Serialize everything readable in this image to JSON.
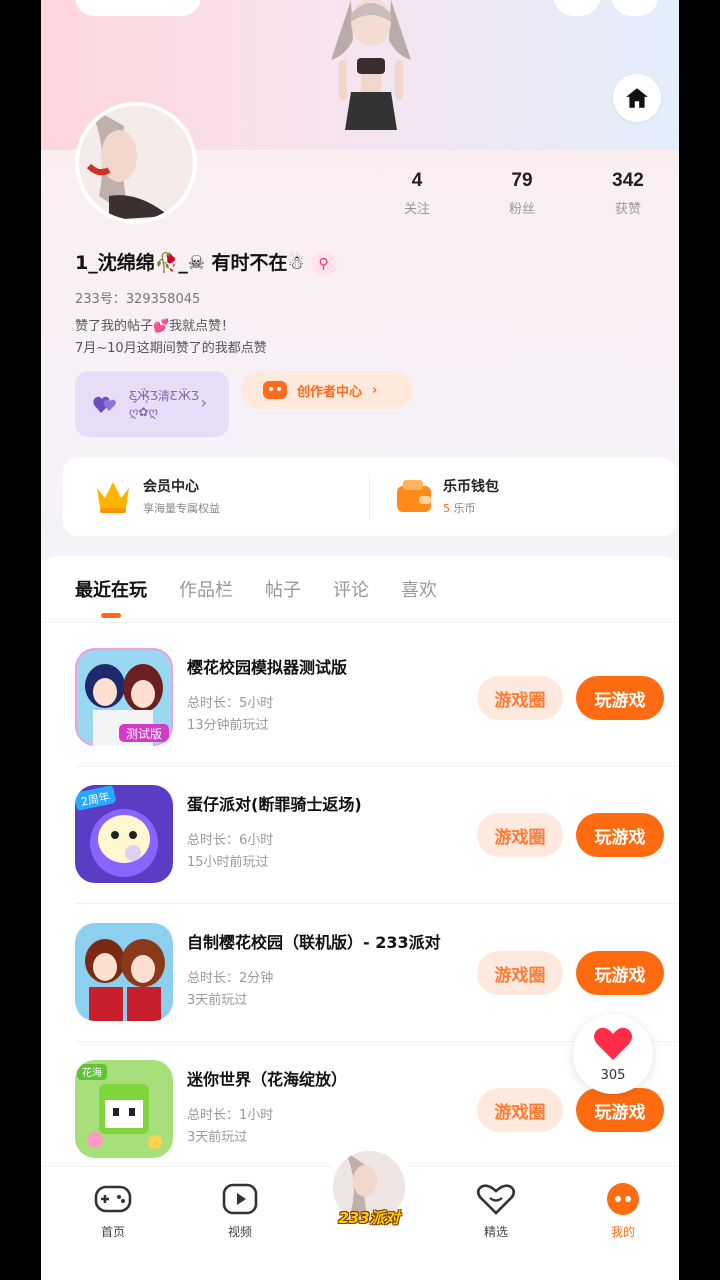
{
  "profile": {
    "nickname": "1_沈绵绵🥀_☠ 有时不在☃",
    "uid": "233号：329358045",
    "bio": [
      "赞了我的帖子💕我就点赞！",
      "7月~10月这期间赞了的我都点赞"
    ],
    "stats": [
      {
        "value": "4",
        "label": "关注"
      },
      {
        "value": "79",
        "label": "粉丝"
      },
      {
        "value": "342",
        "label": "获赞"
      }
    ],
    "friend_card_text": [
      "Ƹ̵̡Ӝ̵̨̄Ʒ清ƸӜƷ",
      "ღ✿ღ"
    ],
    "creator_center": "创作者中心"
  },
  "services": {
    "vip": {
      "title": "会员中心",
      "subtitle": "享海量专属权益"
    },
    "wallet": {
      "title": "乐币钱包",
      "amount": "5",
      "unit": "乐币"
    }
  },
  "tabs": [
    "最近在玩",
    "作品栏",
    "帖子",
    "评论",
    "喜欢"
  ],
  "games": [
    {
      "name": "樱花校园模拟器测试版",
      "duration": "总时长：5小时",
      "last_played": "13分钟前玩过",
      "circle_label": "游戏圈",
      "play_label": "玩游戏",
      "icon_badge": "测试版"
    },
    {
      "name": "蛋仔派对(断罪骑士返场)",
      "duration": "总时长：6小时",
      "last_played": "15小时前玩过",
      "circle_label": "游戏圈",
      "play_label": "玩游戏",
      "icon_badge": "2周年"
    },
    {
      "name": "自制樱花校园（联机版）- 233派对",
      "duration": "总时长：2分钟",
      "last_played": "3天前玩过",
      "circle_label": "游戏圈",
      "play_label": "玩游戏",
      "icon_badge": ""
    },
    {
      "name": "迷你世界（花海绽放）",
      "duration": "总时长：1小时",
      "last_played": "3天前玩过",
      "circle_label": "游戏圈",
      "play_label": "玩游戏",
      "icon_badge": "花海"
    }
  ],
  "like_float": {
    "count": "305"
  },
  "nav": [
    {
      "label": "首页",
      "icon": "gamepad-icon"
    },
    {
      "label": "视频",
      "icon": "video-icon"
    },
    {
      "label": "233派对",
      "icon": "party-avatar"
    },
    {
      "label": "精选",
      "icon": "heart-chat-icon"
    },
    {
      "label": "我的",
      "icon": "profile-face-icon"
    }
  ],
  "colors": {
    "accent": "#ff6b10",
    "accent_light": "#ffe9de",
    "friend_card": "#e7ddf6"
  }
}
